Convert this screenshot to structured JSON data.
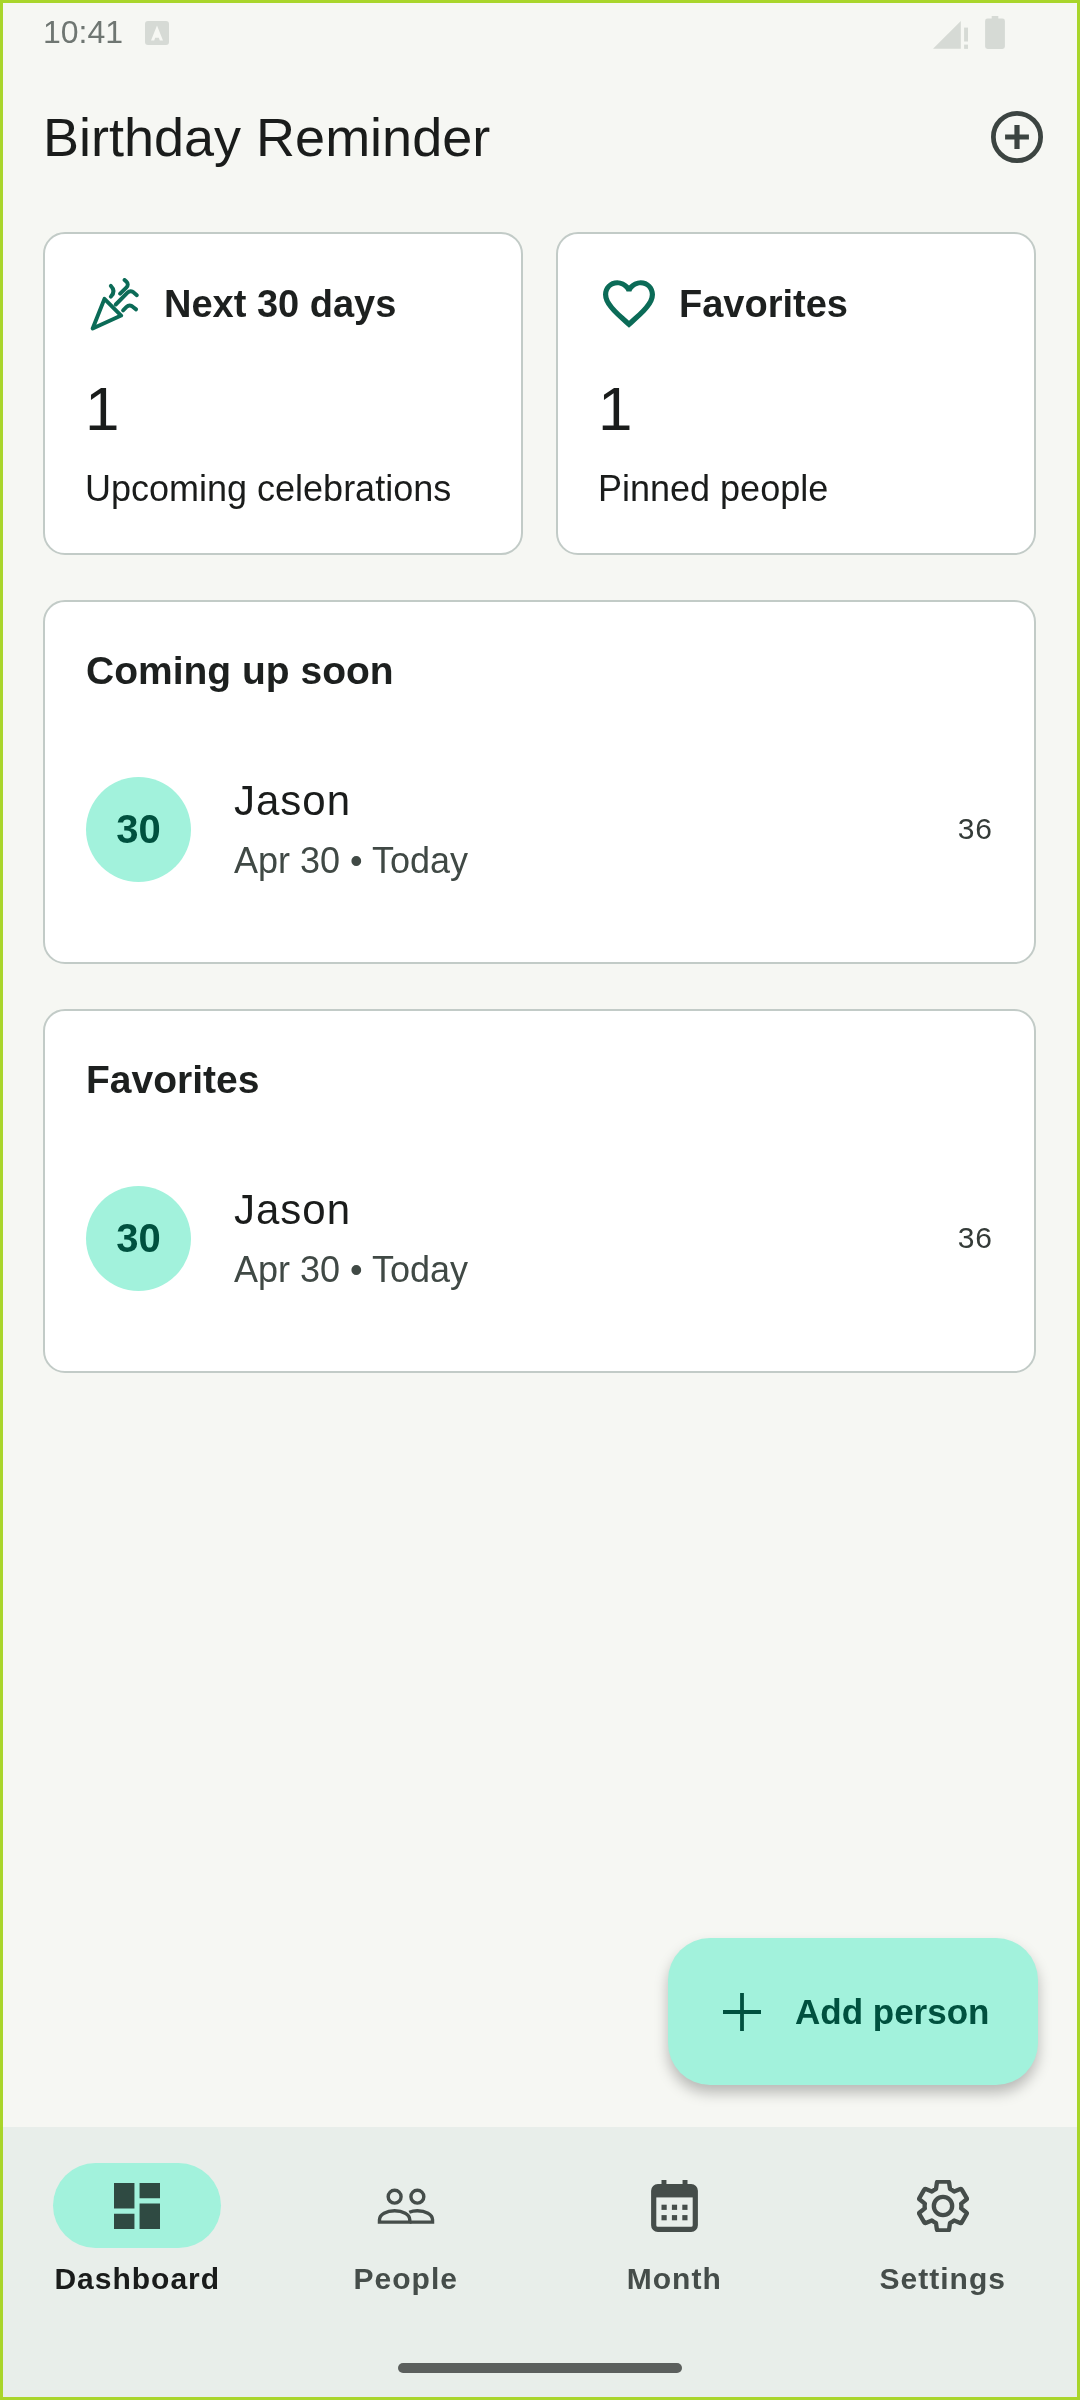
{
  "status_bar": {
    "time": "10:41"
  },
  "app_bar": {
    "title": "Birthday Reminder"
  },
  "summary_cards": [
    {
      "kind": "upcoming",
      "title": "Next 30 days",
      "count": "1",
      "caption": "Upcoming celebrations"
    },
    {
      "kind": "favorites",
      "title": "Favorites",
      "count": "1",
      "caption": "Pinned people"
    }
  ],
  "sections": [
    {
      "title": "Coming up soon",
      "people": [
        {
          "day": "30",
          "name": "Jason",
          "date": "Apr 30 • Today",
          "age": "36"
        }
      ]
    },
    {
      "title": "Favorites",
      "people": [
        {
          "day": "30",
          "name": "Jason",
          "date": "Apr 30 • Today",
          "age": "36"
        }
      ]
    }
  ],
  "fab": {
    "label": "Add person"
  },
  "nav": [
    {
      "kind": "dashboard",
      "label": "Dashboard",
      "selected": true
    },
    {
      "kind": "people",
      "label": "People",
      "selected": false
    },
    {
      "kind": "month",
      "label": "Month",
      "selected": false
    },
    {
      "kind": "settings",
      "label": "Settings",
      "selected": false
    }
  ]
}
